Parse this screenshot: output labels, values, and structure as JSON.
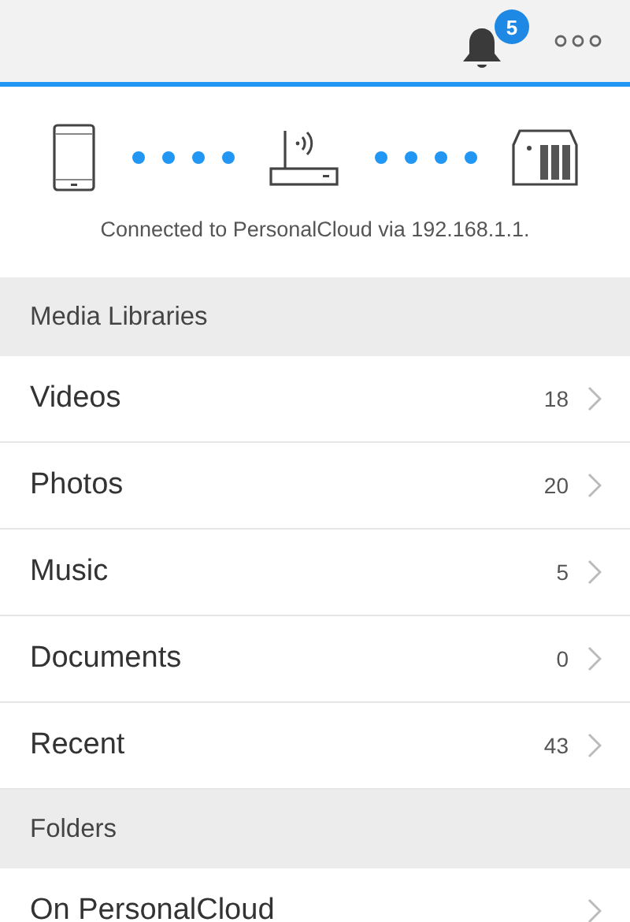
{
  "header": {
    "notification_count": "5"
  },
  "connection": {
    "status": "Connected to PersonalCloud via 192.168.1.1."
  },
  "sections": [
    {
      "title": "Media Libraries",
      "rows": [
        {
          "label": "Videos",
          "count": "18"
        },
        {
          "label": "Photos",
          "count": "20"
        },
        {
          "label": "Music",
          "count": "5"
        },
        {
          "label": "Documents",
          "count": "0"
        },
        {
          "label": "Recent",
          "count": "43"
        }
      ]
    },
    {
      "title": "Folders",
      "rows": [
        {
          "label": "On PersonalCloud"
        }
      ]
    }
  ]
}
